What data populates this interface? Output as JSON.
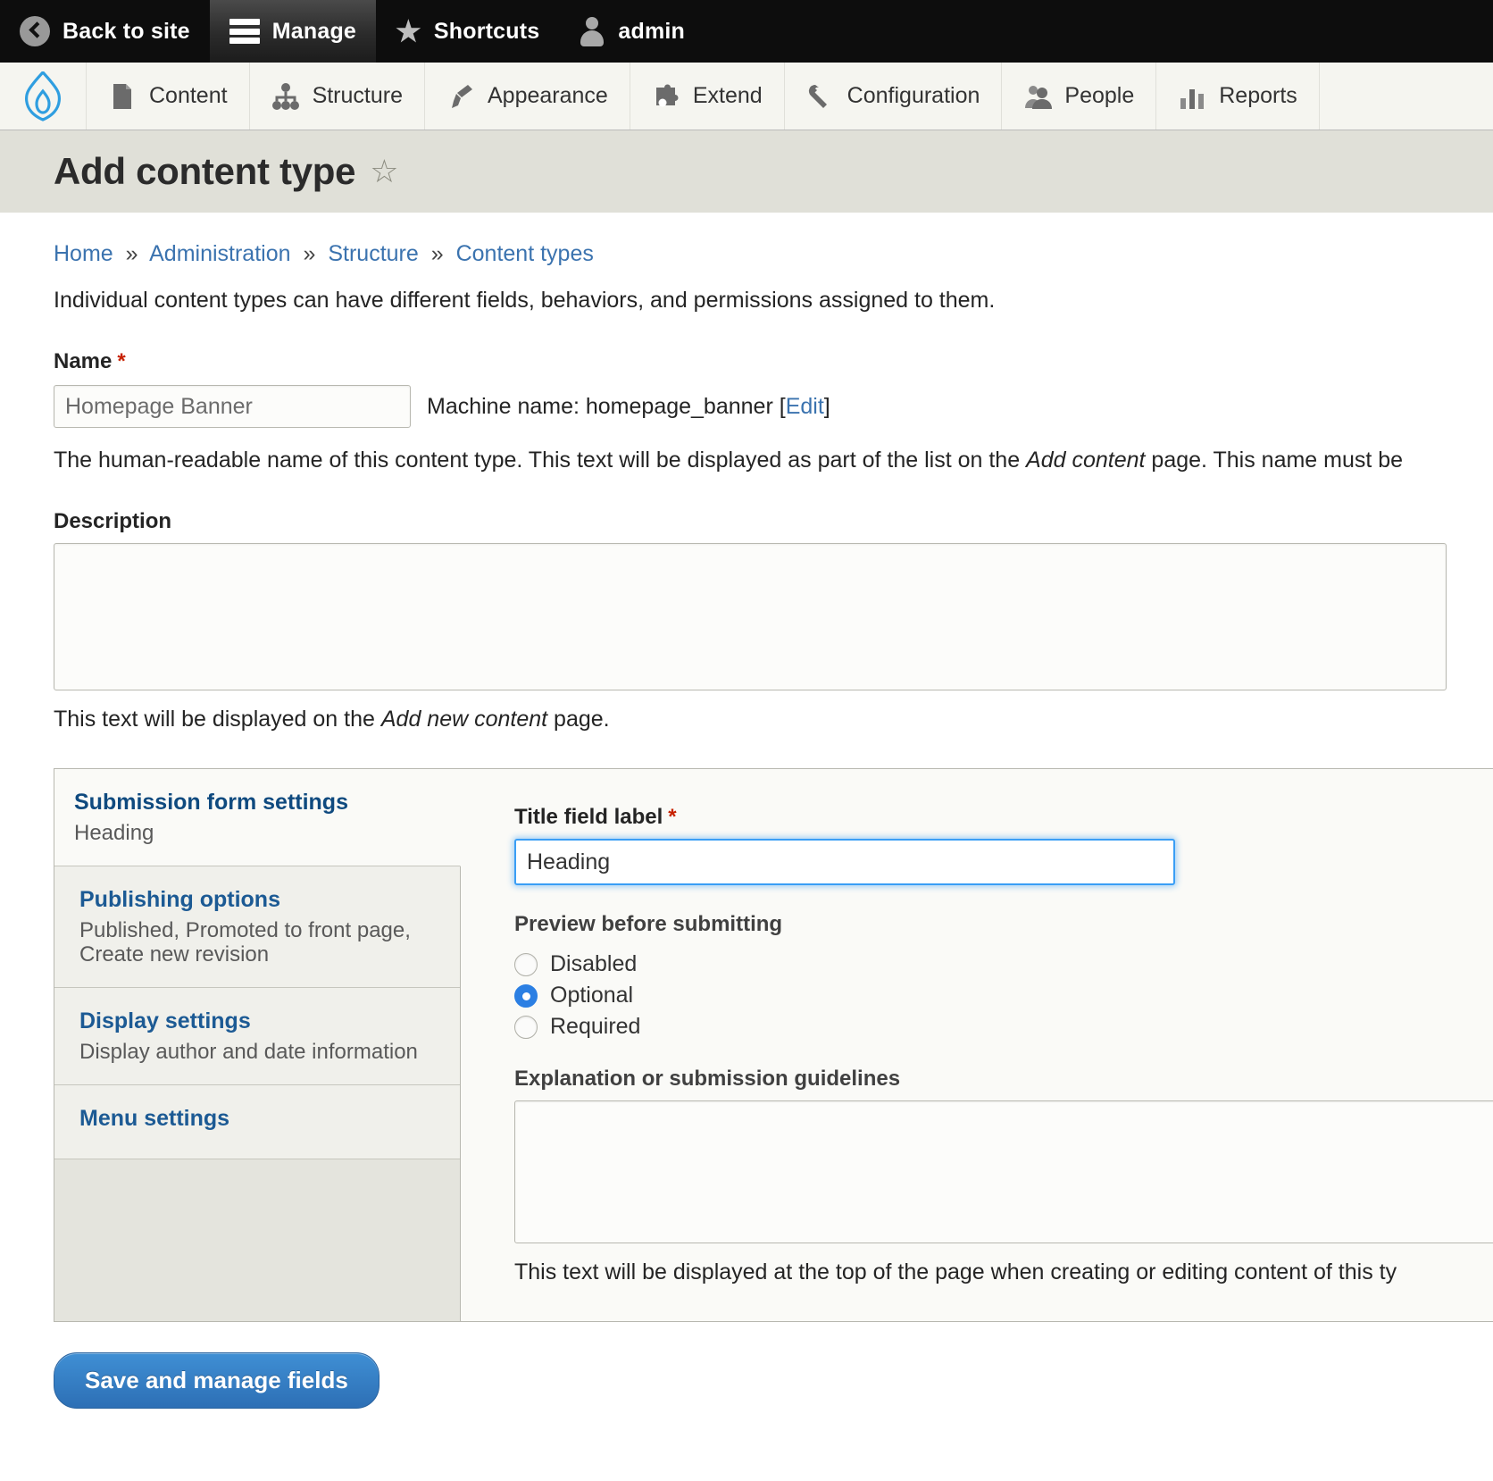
{
  "toolbar": {
    "back_to_site": "Back to site",
    "manage": "Manage",
    "shortcuts": "Shortcuts",
    "account": "admin"
  },
  "admin_menu": {
    "items": [
      {
        "label": "Content",
        "icon": "file-icon"
      },
      {
        "label": "Structure",
        "icon": "sitemap-icon"
      },
      {
        "label": "Appearance",
        "icon": "paintbrush-icon"
      },
      {
        "label": "Extend",
        "icon": "puzzle-icon"
      },
      {
        "label": "Configuration",
        "icon": "wrench-icon"
      },
      {
        "label": "People",
        "icon": "people-icon"
      },
      {
        "label": "Reports",
        "icon": "bar-chart-icon"
      }
    ]
  },
  "page": {
    "title": "Add content type",
    "breadcrumb": [
      "Home",
      "Administration",
      "Structure",
      "Content types"
    ],
    "breadcrumb_separator": "»",
    "intro": "Individual content types can have different fields, behaviors, and permissions assigned to them."
  },
  "form": {
    "name": {
      "label": "Name",
      "required_mark": "*",
      "value": "Homepage Banner",
      "placeholder": "",
      "machine_name_prefix": "Machine name: ",
      "machine_name": "homepage_banner",
      "machine_name_edit": "Edit",
      "machine_name_open": " [",
      "machine_name_close": "]",
      "help_pre": "The human-readable name of this content type. This text will be displayed as part of the list on the ",
      "help_em": "Add content",
      "help_post": " page. This name must be"
    },
    "description": {
      "label": "Description",
      "value": "",
      "placeholder": "",
      "help_pre": "This text will be displayed on the ",
      "help_em": "Add new content",
      "help_post": " page."
    },
    "submit_label": "Save and manage fields"
  },
  "vertical_tabs": {
    "items": [
      {
        "title": "Submission form settings",
        "summary": "Heading",
        "selected": true
      },
      {
        "title": "Publishing options",
        "summary": "Published, Promoted to front page, Create new revision",
        "selected": false
      },
      {
        "title": "Display settings",
        "summary": "Display author and date information",
        "selected": false
      },
      {
        "title": "Menu settings",
        "summary": "",
        "selected": false
      }
    ],
    "pane": {
      "title_field_label": "Title field label",
      "title_field_required": "*",
      "title_field_value": "Heading",
      "preview_label": "Preview before submitting",
      "preview_options": [
        {
          "label": "Disabled",
          "selected": false
        },
        {
          "label": "Optional",
          "selected": true
        },
        {
          "label": "Required",
          "selected": false
        }
      ],
      "explanation_label": "Explanation or submission guidelines",
      "explanation_value": "",
      "explanation_help": "This text will be displayed at the top of the page when creating or editing content of this ty"
    }
  },
  "colors": {
    "toolbar_bg": "#0d0d0d",
    "menu_bg": "#f5f5f0",
    "title_bar_bg": "#e0e0d8",
    "link": "#3b73af",
    "tab_link": "#1c5a94",
    "required": "#c72100",
    "accent_focus": "#3a9ef5",
    "radio_selected": "#2b7fe3",
    "button": "#2d6fb5",
    "drupal_blue": "#2f9ee0"
  }
}
